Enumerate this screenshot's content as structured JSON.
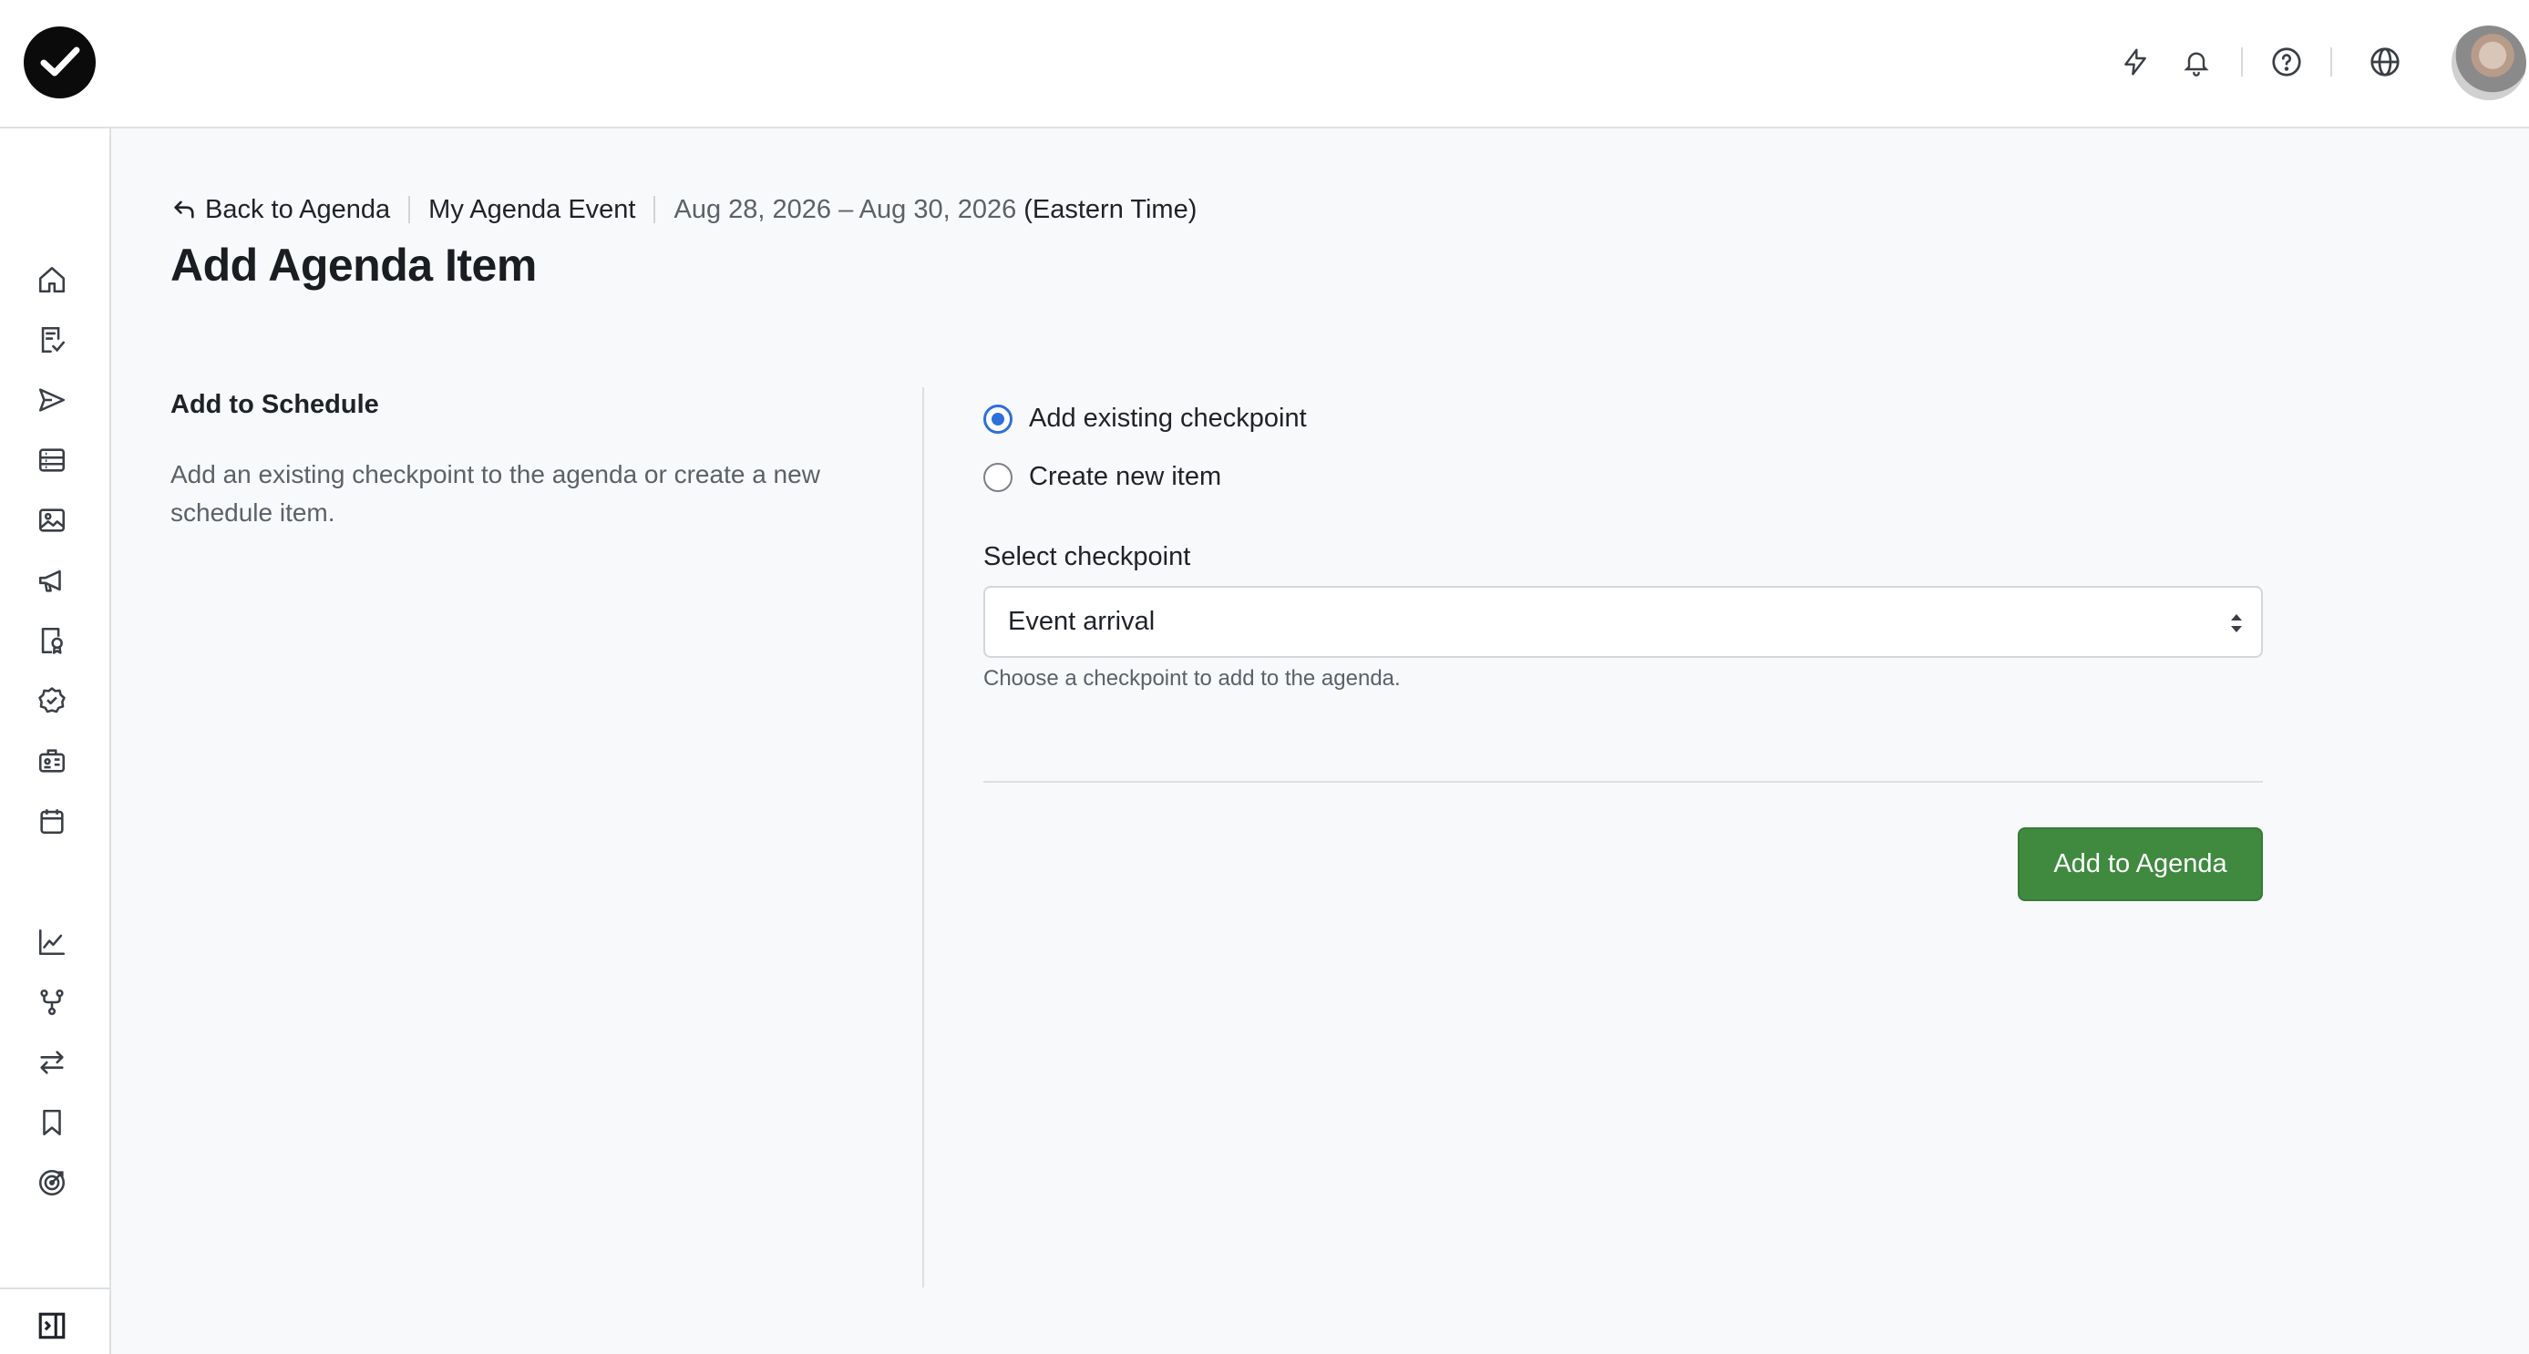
{
  "app": {
    "logo_icon": "check-circle-logo-icon"
  },
  "topbar": {
    "icons": [
      "lightning-icon",
      "bell-icon",
      "help-circle-icon",
      "globe-icon"
    ],
    "avatar": "user-avatar"
  },
  "sidebar": {
    "items": [
      {
        "icon": "home-icon"
      },
      {
        "icon": "checklist-icon"
      },
      {
        "icon": "send-icon"
      },
      {
        "icon": "list-card-icon"
      },
      {
        "icon": "image-icon"
      },
      {
        "icon": "megaphone-icon"
      },
      {
        "icon": "badge-document-icon"
      },
      {
        "icon": "check-shield-icon"
      },
      {
        "icon": "id-card-icon"
      },
      {
        "icon": "calendar-icon"
      },
      {
        "icon": "chart-line-icon"
      },
      {
        "icon": "branch-icon"
      },
      {
        "icon": "transfer-icon"
      },
      {
        "icon": "bookmark-icon"
      },
      {
        "icon": "target-icon"
      }
    ],
    "collapse_icon": "sidebar-toggle-icon"
  },
  "breadcrumb": {
    "back_label": "Back to Agenda",
    "event_name": "My Agenda Event",
    "dates": "Aug 28, 2026 – Aug 30, 2026",
    "timezone": "(Eastern Time)"
  },
  "page": {
    "title": "Add Agenda Item"
  },
  "section": {
    "title": "Add to Schedule",
    "description": "Add an existing checkpoint to the agenda or create a new schedule item."
  },
  "form": {
    "options": [
      {
        "label": "Add existing checkpoint",
        "checked": true
      },
      {
        "label": "Create new item",
        "checked": false
      }
    ],
    "select_label": "Select checkpoint",
    "select_value": "Event arrival",
    "help_text": "Choose a checkpoint to add to the agenda.",
    "submit_label": "Add to Agenda"
  },
  "colors": {
    "accent": "#2f6fdb",
    "primary_button": "#3f8a3f"
  }
}
